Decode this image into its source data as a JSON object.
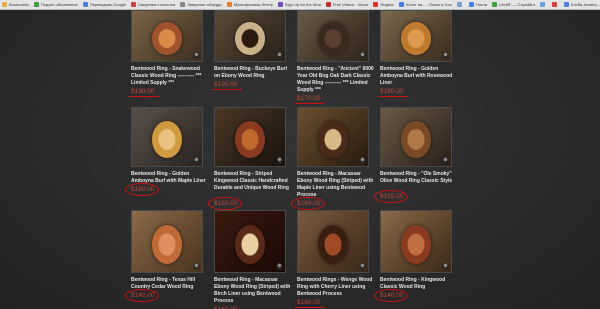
{
  "bookmarks": [
    {
      "label": "Bookmarks",
      "color": "#e0b040"
    },
    {
      "label": "Подать объявление",
      "color": "#3aa040"
    },
    {
      "label": "Переводчик Google",
      "color": "#4a80e0"
    },
    {
      "label": "Сведения статистик",
      "color": "#d04040"
    },
    {
      "label": "Ливерное оборудо",
      "color": "#888888"
    },
    {
      "label": "Мультфильмы Интер",
      "color": "#e08030"
    },
    {
      "label": "Sign Up for the Woo",
      "color": "#7050b0"
    },
    {
      "label": "Free Videos - Wood",
      "color": "#c03030"
    },
    {
      "label": "Яндекс",
      "color": "#e03030"
    },
    {
      "label": "Хочет на... - Поиск в Goo",
      "color": "#4a80e0"
    },
    {
      "label": "",
      "color": "#7aa0d0"
    },
    {
      "label": "Почта",
      "color": "#4a80e0"
    },
    {
      "label": "LiteMF — Служба п",
      "color": "#3aa040"
    },
    {
      "label": "",
      "color": "#60a0e0"
    },
    {
      "label": "",
      "color": "#d04040"
    },
    {
      "label": "Котба Jewelry—Goo",
      "color": "#4a80e0"
    }
  ],
  "products": [
    {
      "title": "Bentwood Ring - Snakewood Classic Wood Ring ---------- *** Limited Supply ***",
      "price": "$190.00",
      "image": "snakewood-ring"
    },
    {
      "title": "Bentwood Ring - Buckeye Burl on Ebony Wood Ring",
      "price": "$195.00",
      "image": "buckeye-burl-ring"
    },
    {
      "title": "Bentwood Ring - \"Ancient\" 6000 Year Old Bog Oak Dark Classic Wood Ring ---------- *** Limited Supply ***",
      "price": "$170.00",
      "image": "bog-oak-ring"
    },
    {
      "title": "Bentwood Ring - Golden Amboyna Burl with Rosewood Liner",
      "price": "$180.00",
      "image": "amboyna-rosewood-ring"
    },
    {
      "title": "Bentwood Ring - Golden Amboyna Burl with Maple Liner",
      "price": "$180.00",
      "image": "amboyna-maple-ring"
    },
    {
      "title": "Bentwood Ring - Striped Kingwood Classic Handcrafted Durable and Unique Wood Ring",
      "price": "$160.00",
      "image": "striped-kingwood-ring"
    },
    {
      "title": "Bentwood Ring - Macassar Ebony Wood Ring (Striped) with Maple Liner using Bentwood Process",
      "price": "$160.00",
      "image": "macassar-maple-ring"
    },
    {
      "title": "Bentwood Ring - \"Ole Smoky\" Olive Wood Ring Classic Style",
      "price": "$155.00",
      "image": "olive-wood-ring"
    },
    {
      "title": "Bentwood Ring - Texas Hill Country Cedar Wood Ring",
      "price": "$140.00",
      "image": "cedar-ring"
    },
    {
      "title": "Bentwood Ring - Macassar Ebony Wood Ring (Striped) with Birch Liner using Bentwood Process",
      "price": "$160.00",
      "image": "macassar-birch-ring"
    },
    {
      "title": "Bentwood Rings - Wenge Wood Ring with Cherry Liner using Bentwood Process",
      "price": "$160.00",
      "image": "wenge-cherry-ring"
    },
    {
      "title": "Bentwood Ring - Kingwood Classic Wood Ring",
      "price": "$140.00",
      "image": "kingwood-ring"
    }
  ],
  "zoom_icon": "magnify-icon",
  "colors": {
    "price": "#c04a3a",
    "annotation": "#d01010",
    "background": "#2b2b2b"
  }
}
